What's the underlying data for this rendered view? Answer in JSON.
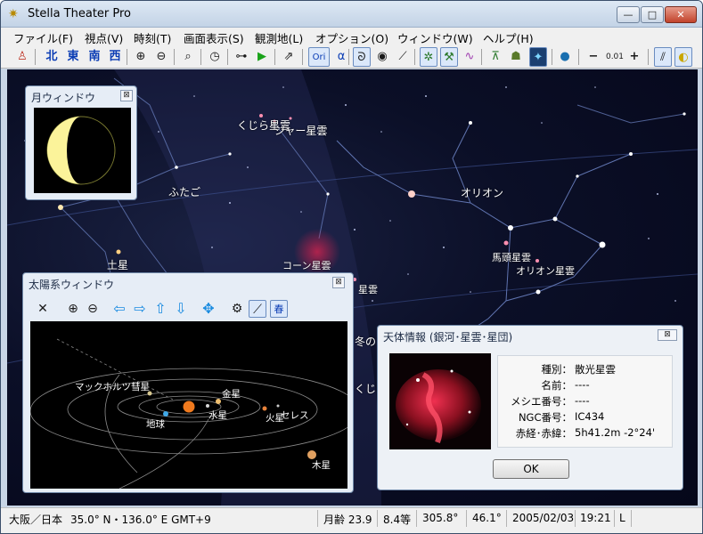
{
  "window": {
    "title": "Stella Theater Pro",
    "minimize": "—",
    "maximize": "□",
    "close": "✕"
  },
  "menu": [
    "ファイル(F)",
    "視点(V)",
    "時刻(T)",
    "画面表示(S)",
    "観測地(L)",
    "オプション(O)",
    "ウィンドウ(W)",
    "ヘルプ(H)"
  ],
  "toolbar": {
    "directions": [
      "北",
      "東",
      "南",
      "西"
    ],
    "ori_label": "Ori",
    "alpha_label": "α",
    "zoom_minus": "−",
    "zoom_value": "0.01",
    "zoom_plus": "+"
  },
  "sky": {
    "labels": [
      "くじら星雲",
      "ジャー星雲",
      "ふたご",
      "オリオン",
      "土星",
      "コーン星雲",
      "馬頭星雲",
      "オリオン星雲",
      "冬の",
      "くじ",
      "星雲"
    ]
  },
  "moon_window": {
    "title": "月ウィンドウ",
    "close": "⊠"
  },
  "solar_window": {
    "title": "太陽系ウィンドウ",
    "close": "⊠",
    "season_label": "春",
    "labels": {
      "comet": "マックホルツ彗星",
      "venus": "金星",
      "earth": "地球",
      "mercury": "水星",
      "mars": "火星",
      "ceres": "セレス",
      "jupiter": "木星"
    }
  },
  "info_dialog": {
    "title": "天体情報 (銀河･星雲･星団)",
    "close": "⊠",
    "rows": [
      {
        "key": "種別：",
        "value": "散光星雲"
      },
      {
        "key": "名前：",
        "value": "----"
      },
      {
        "key": "メシエ番号：",
        "value": "----"
      },
      {
        "key": "NGC番号：",
        "value": "IC434"
      },
      {
        "key": "赤経･赤緯：",
        "value": "5h41.2m  -2°24'"
      }
    ],
    "ok": "OK"
  },
  "status": {
    "location": "大阪／日本",
    "coords": "35.0° N・136.0° E  GMT+9",
    "moon_age": "月齢 23.9",
    "magnitude": "8.4等",
    "azimuth": "305.8°",
    "altitude": "46.1°",
    "date": "2005/02/03",
    "time": "19:21",
    "mode": "L"
  },
  "colors": {
    "sky": "#0b0f27",
    "moon": "#fbf39a",
    "sun": "#f07a1e",
    "accent": "#1a8be0"
  }
}
